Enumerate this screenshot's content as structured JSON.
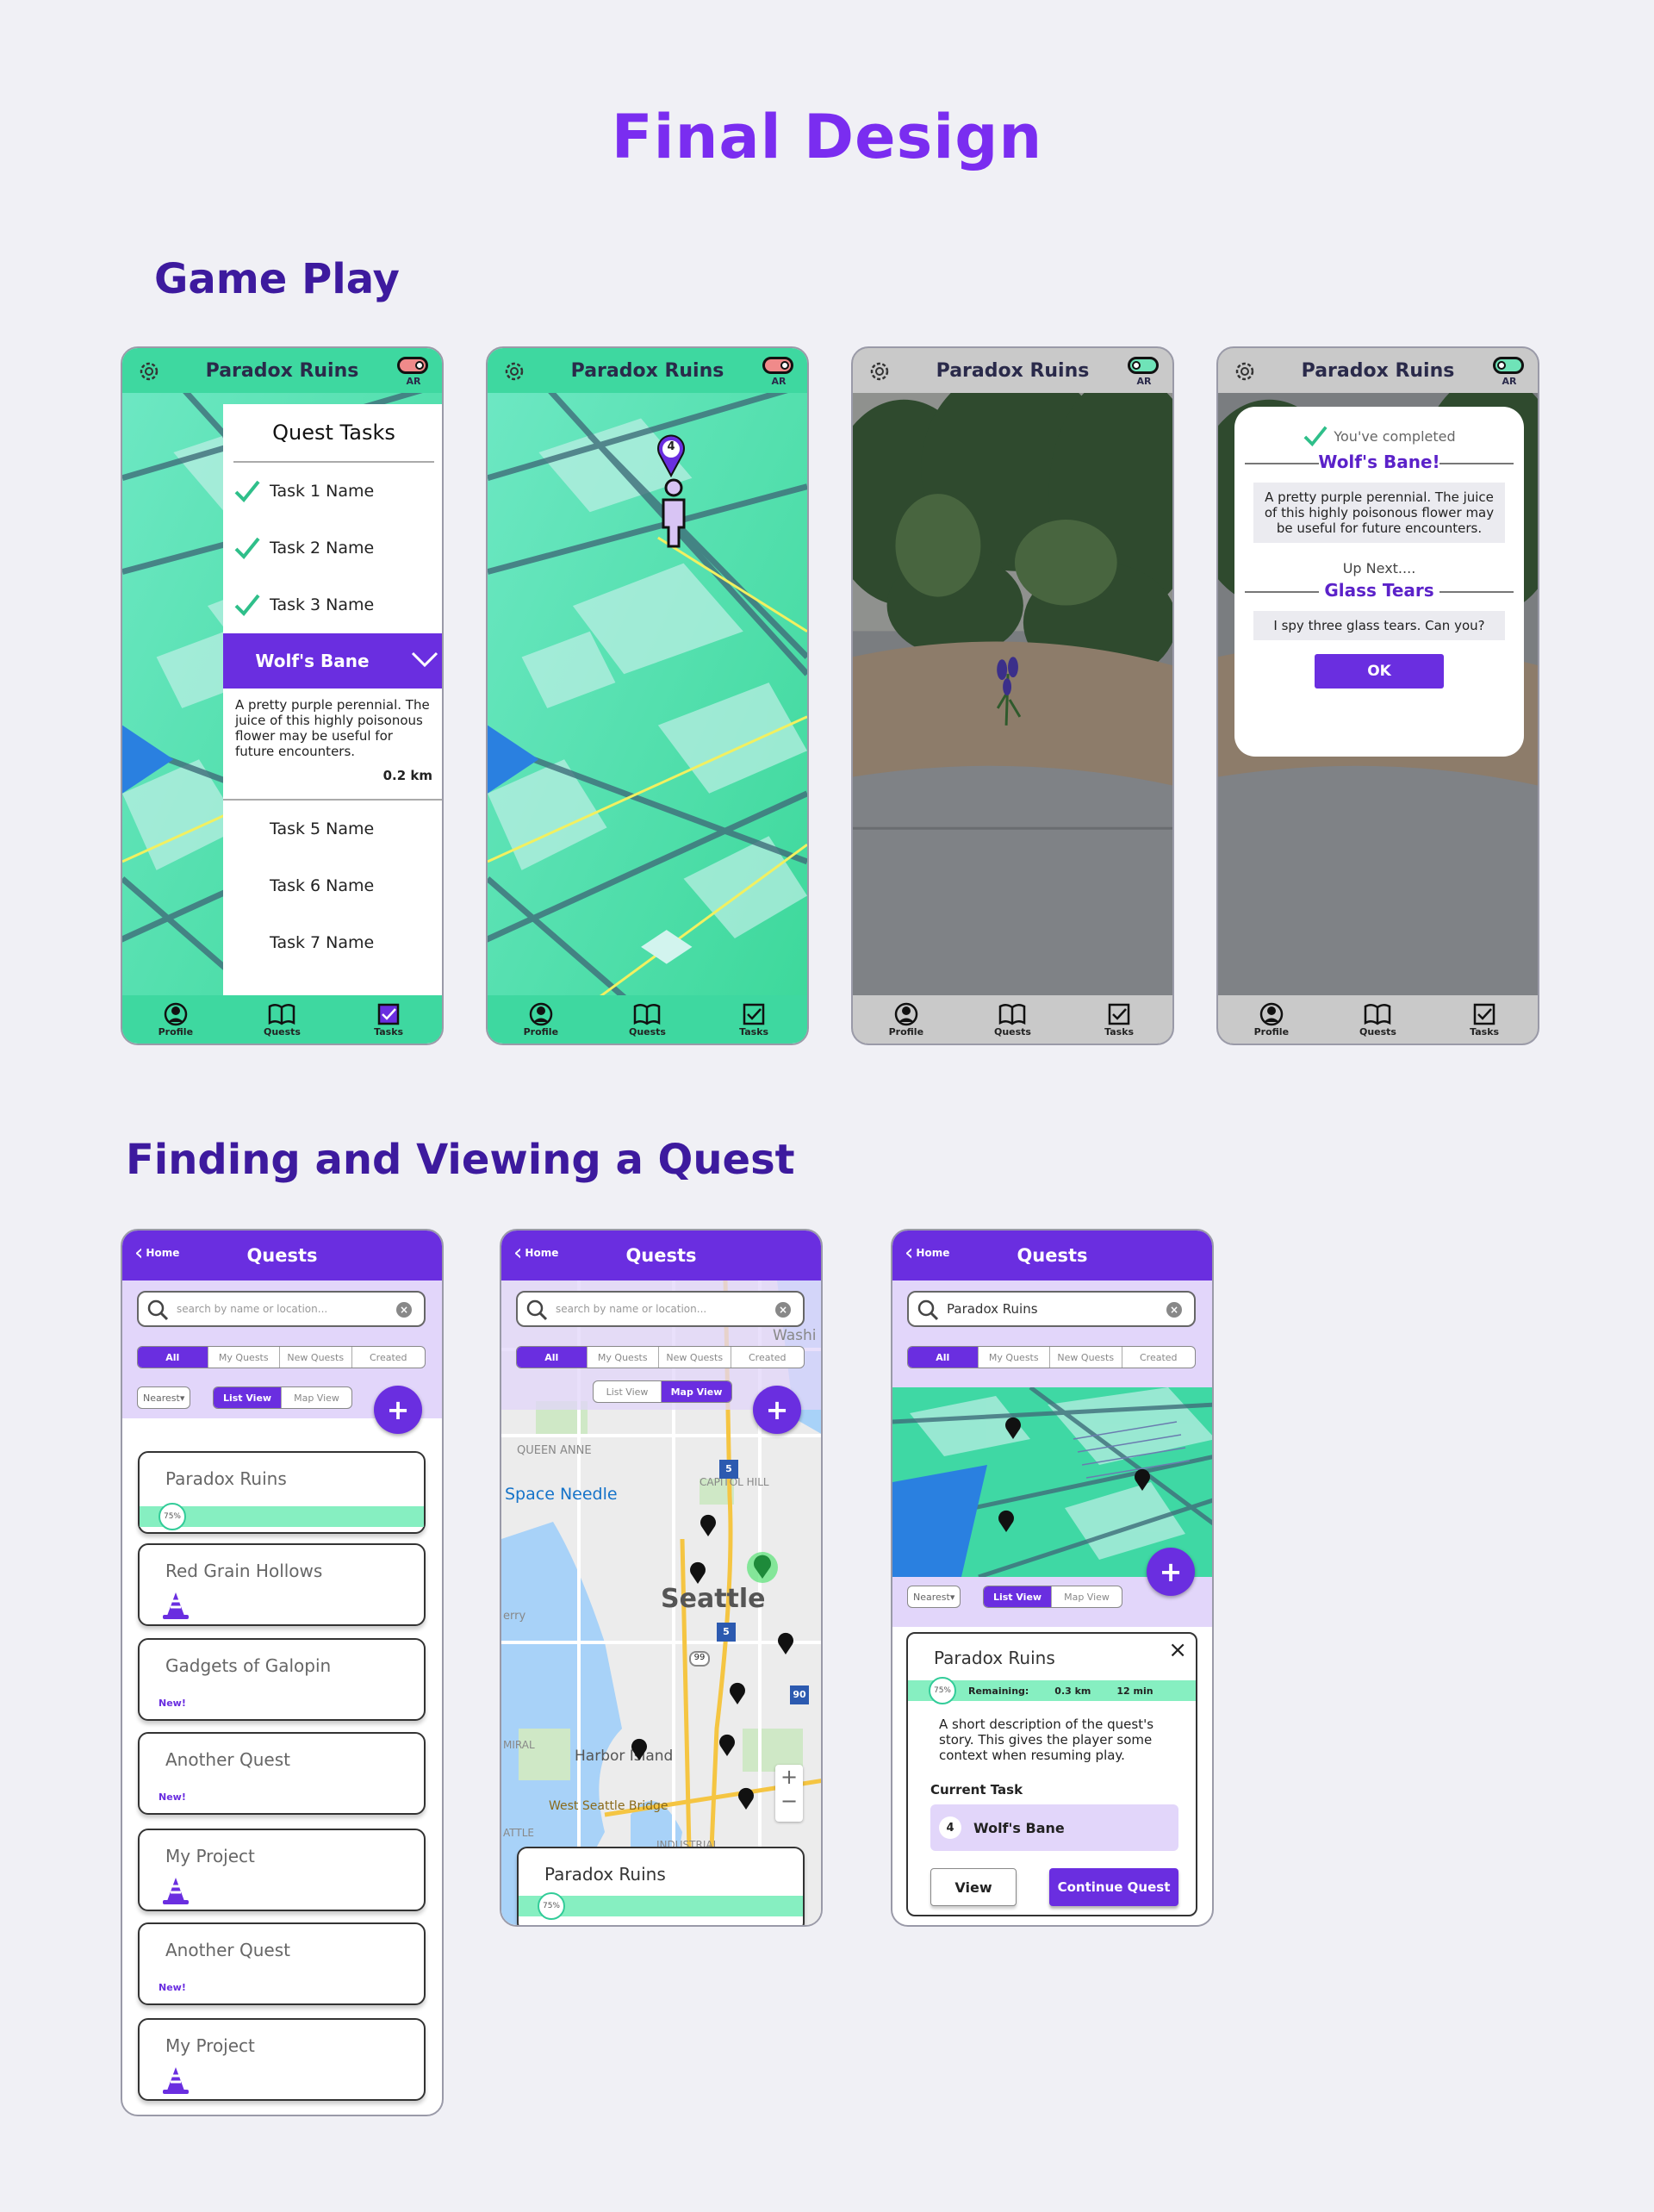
{
  "page_title": "Final Design",
  "sections": {
    "gameplay": "Game Play",
    "finding": "Finding and Viewing a Quest"
  },
  "gameplay": {
    "location": "Paradox Ruins",
    "ar": "AR",
    "nav": [
      "Profile",
      "Quests",
      "Tasks"
    ],
    "tasks_panel": {
      "title": "Quest Tasks",
      "done": [
        "Task 1 Name",
        "Task 2 Name",
        "Task 3 Name"
      ],
      "active": "Wolf's Bane",
      "desc": "A pretty purple perennial. The juice of this highly poisonous flower may be useful for future encounters.",
      "distance": "0.2 km",
      "pending": [
        "Task 5 Name",
        "Task 6 Name",
        "Task 7 Name"
      ]
    },
    "marker_number": "4",
    "dialog": {
      "completed": "You've completed",
      "title": "Wolf's Bane!",
      "desc": "A pretty purple perennial. The juice of this highly poisonous flower may be useful for future encounters.",
      "up_next": "Up Next....",
      "next_title": "Glass Tears",
      "next_desc": "I spy three glass tears. Can you?",
      "ok": "OK"
    }
  },
  "quests": {
    "home": "Home",
    "title": "Quests",
    "search_placeholder": "search by name or location...",
    "search_value": "Paradox Ruins",
    "filters": [
      "All",
      "My Quests",
      "New Quests",
      "Created"
    ],
    "sort": "Nearest",
    "views": [
      "List View",
      "Map View"
    ],
    "add": "+",
    "list": [
      {
        "name": "Paradox Ruins",
        "progress": "75%"
      },
      {
        "name": "Red Grain Hollows",
        "icon": "cone-icon"
      },
      {
        "name": "Gadgets of Galopin",
        "badge": "New!"
      },
      {
        "name": "Another Quest",
        "badge": "New!"
      },
      {
        "name": "My Project",
        "icon": "cone-icon"
      },
      {
        "name": "Another Quest",
        "badge": "New!"
      },
      {
        "name": "My Project",
        "icon": "cone-icon"
      }
    ],
    "map_labels": {
      "city": "Seattle",
      "needle": "Space Needle",
      "queen": "QUEEN ANNE",
      "capitol": "CAPITOL HILL",
      "harbor": "Harbor Island",
      "bridge": "West Seattle Bridge",
      "industrial": "INDUSTRIAL",
      "wash": "Washi",
      "attle": "ATTLE",
      "mira": "MIRAL",
      "erry": "erry",
      "highway": "99",
      "i5": "5",
      "i90": "90",
      "plus": "+",
      "minus": "−"
    },
    "detail": {
      "name": "Paradox Ruins",
      "progress": "75%",
      "remaining_label": "Remaining:",
      "remaining_km": "0.3 km",
      "remaining_min": "12 min",
      "desc": "A short description of the quest's story. This gives the player some context when resuming play.",
      "current_task_label": "Current Task",
      "task_number": "4",
      "task_name": "Wolf's Bane",
      "view": "View",
      "continue": "Continue Quest",
      "close": "×"
    }
  },
  "colors": {
    "purple": "#6a2ee0",
    "title": "#7a2df0",
    "heading": "#3d1a9e",
    "map_green": "#3fe0a0",
    "progress": "#86efc1"
  }
}
